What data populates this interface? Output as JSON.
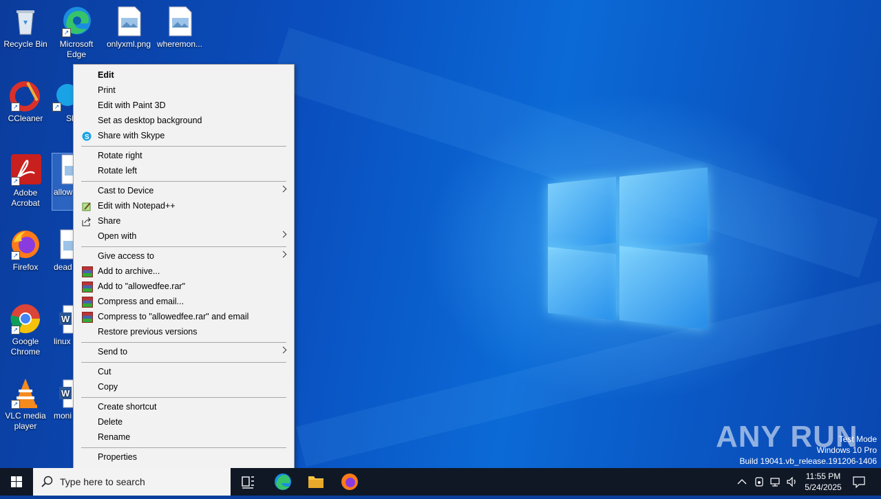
{
  "desktop_icons": [
    {
      "label": "Recycle Bin",
      "icon": "recycle-bin-icon"
    },
    {
      "label": "Microsoft Edge",
      "icon": "edge-icon"
    },
    {
      "label": "onlyxml.png",
      "icon": "image-file-icon"
    },
    {
      "label": "wheremon...",
      "icon": "image-file-icon"
    },
    {
      "label": "CCleaner",
      "icon": "ccleaner-icon"
    },
    {
      "label": "Sk",
      "icon": "skype-icon"
    },
    {
      "label": "Adobe Acrobat",
      "icon": "acrobat-icon"
    },
    {
      "label": "allow",
      "icon": "image-file-icon"
    },
    {
      "label": "Firefox",
      "icon": "firefox-icon"
    },
    {
      "label": "dead",
      "icon": "image-file-icon"
    },
    {
      "label": "Google Chrome",
      "icon": "chrome-icon"
    },
    {
      "label": "linux",
      "icon": "word-doc-icon"
    },
    {
      "label": "VLC media player",
      "icon": "vlc-icon"
    },
    {
      "label": "moni",
      "icon": "word-doc-icon"
    }
  ],
  "context_menu": {
    "items": [
      {
        "label": "Edit",
        "bold": true
      },
      {
        "label": "Print"
      },
      {
        "label": "Edit with Paint 3D"
      },
      {
        "label": "Set as desktop background"
      },
      {
        "label": "Share with Skype",
        "icon": "skype-icon"
      },
      {
        "label": "Rotate right"
      },
      {
        "label": "Rotate left"
      },
      {
        "label": "Cast to Device",
        "submenu": true
      },
      {
        "label": "Edit with Notepad++",
        "icon": "notepadpp-icon"
      },
      {
        "label": "Share",
        "icon": "share-icon"
      },
      {
        "label": "Open with",
        "submenu": true
      },
      {
        "label": "Give access to",
        "submenu": true
      },
      {
        "label": "Add to archive...",
        "icon": "winrar-icon"
      },
      {
        "label": "Add to \"allowedfee.rar\"",
        "icon": "winrar-icon"
      },
      {
        "label": "Compress and email...",
        "icon": "winrar-icon"
      },
      {
        "label": "Compress to \"allowedfee.rar\" and email",
        "icon": "winrar-icon"
      },
      {
        "label": "Restore previous versions"
      },
      {
        "label": "Send to",
        "submenu": true
      },
      {
        "label": "Cut"
      },
      {
        "label": "Copy"
      },
      {
        "label": "Create shortcut"
      },
      {
        "label": "Delete"
      },
      {
        "label": "Rename"
      },
      {
        "label": "Properties"
      }
    ]
  },
  "taskbar": {
    "search_placeholder": "Type here to search",
    "time": "11:55 PM",
    "date": "5/24/2025"
  },
  "watermark": {
    "brand": "ANY RUN",
    "line1": "Test Mode",
    "line2": "Windows 10 Pro",
    "line3": "Build 19041.vb_release.191206-1406"
  }
}
